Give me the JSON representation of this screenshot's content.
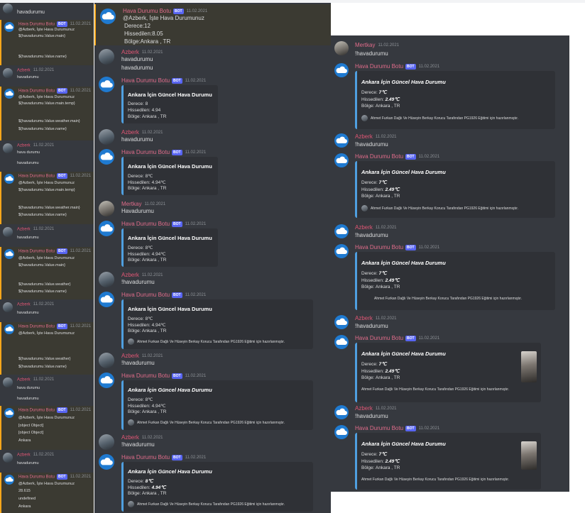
{
  "bot_name": "Hava Durumu Botu",
  "bot_badge": "BOT",
  "user_name": "Azberk",
  "user2_name": "Mertkay",
  "date": "11.02.2021",
  "accent_color": "#4f9fe0",
  "icons": {
    "bot_avatar": "cloud-icon",
    "user_avatar": "user-photo-icon"
  },
  "col1": {
    "lines": {
      "l0": "havadurumu",
      "l1": "@Azberk, İşte Hava Durumunuz",
      "l2": "${havadurumu.Value.main}",
      "l3": "${havadurumu.Value.name}",
      "l4": "havadurumu",
      "l5": "@Azberk, İşte Hava Durumunuz",
      "l6": "${havadurumu.Value.main.temp}",
      "l7": "${havadurumu.Value.weather.main}",
      "l8": "${havadurumu.Value.name}",
      "l9": "hava durumu",
      "l10": "havadurumu",
      "l11": "@Azberk, İşte Hava Durumunuz",
      "l12": "${havadurumu.Value.main.temp}",
      "l13": "${havadurumu.Value.weather.main}",
      "l14": "${havadurumu.Value.name}",
      "l15": "havadurumu",
      "l16": "@Azberk, İşte Hava Durumunuz",
      "l17": "${havadurumu.Value.main}",
      "l18": "${havadurumu.Value.weather}",
      "l19": "${havadurumu.Value.name}",
      "l20": "havadurumu",
      "l21": "@Azberk, İşte Hava Durumunuz",
      "l22": "${havadurumu.Value.weather}",
      "l23": "${havadurumu.Value.name}",
      "l24": "hava durumu",
      "l25": "havadurumu",
      "l26": "@Azberk, İşte Hava Durumunuz",
      "l27": "[object Object]",
      "l28": "[object Object]",
      "l29": "Ankara",
      "l30": "havadurumu",
      "l31": "@Azberk, İşte Hava Durumunuz",
      "l32": "28.615",
      "l33": "undefined",
      "l34": "Ankara"
    }
  },
  "col2": {
    "plain": {
      "mention": "@Azberk, İşte Hava Durumunuz",
      "derece": "Derece:12",
      "hissedilen": "Hissedilen:8.05",
      "bolge": "Bölge:Ankara , TR"
    },
    "cmd1": "havadurumu",
    "cmd1b": "havadurumu",
    "cmd2": "havadurumu",
    "cmd3": "Havadurumu",
    "cmd4": "!havadurumu",
    "cmd5": "!havadurumu",
    "cmd6": "!havadurumu"
  },
  "col3": {
    "cmd1": "!havadurumu",
    "cmd2": "!havadurumu",
    "cmd3": "!havadurumu",
    "cmd4": "!havadurumu",
    "cmd5": "!havadurumu"
  },
  "embed": {
    "title": "Ankara İçin Güncel Hava Durumu",
    "bolge": "Bölge: Ankara , TR",
    "footer": "Ahmet Furkan Dağlı Ve Hüseyin Berkay Korucu Tarafından PG1926 Eğitimi için hazırlanmıştır.",
    "e1": {
      "derece": "Derece: 8",
      "hissedilen": "Hissedilen: 4.94"
    },
    "e2": {
      "derece": "Derece: 8℃",
      "hissedilen": "Hissedilen: 4.94℃"
    },
    "e7": {
      "derece_label": "Derece: ",
      "derece_val": "8℃",
      "hissedilen_label": "Hissedilen: ",
      "hissedilen_val": "4.94℃"
    },
    "r": {
      "derece_label": "Derece: ",
      "derece_val": "7℃",
      "hissedilen_label": "Hissedilen: ",
      "hissedilen_val": "2.49℃"
    }
  }
}
